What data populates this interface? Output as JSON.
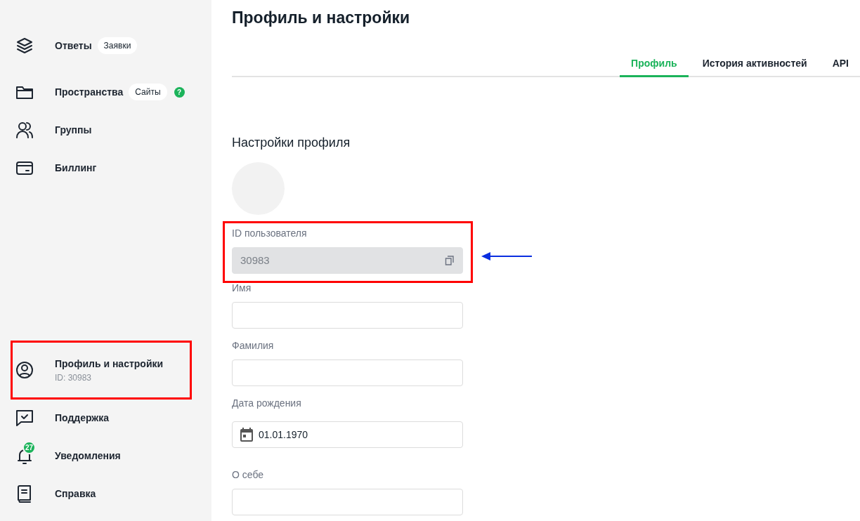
{
  "sidebar": {
    "top_items": [
      {
        "label": "Ответы",
        "tag": "Заявки"
      },
      {
        "label": "Пространства",
        "tag": "Сайты",
        "help": "?"
      },
      {
        "label": "Группы"
      },
      {
        "label": "Биллинг"
      }
    ],
    "bottom_items": [
      {
        "label": "Профиль и настройки",
        "sub": "ID: 30983",
        "annotated": true
      },
      {
        "label": "Поддержка",
        "annotated": false
      },
      {
        "label": "Уведомления",
        "count": "27",
        "annotated": false
      },
      {
        "label": "Справка",
        "annotated": false
      }
    ]
  },
  "page": {
    "title": "Профиль и настройки",
    "tabs": [
      {
        "label": "Профиль",
        "selected": true
      },
      {
        "label": "История активностей",
        "selected": false
      },
      {
        "label": "API",
        "selected": false
      }
    ],
    "section_title": "Настройки профиля",
    "fields": [
      {
        "kind": "readonly",
        "label": "ID пользователя",
        "value": "30983",
        "annotated": true
      },
      {
        "kind": "text",
        "label": "Имя",
        "annotated": false
      },
      {
        "kind": "text",
        "label": "Фамилия",
        "annotated": false
      },
      {
        "kind": "date",
        "label": "Дата рождения",
        "value": "01.01.1970",
        "annotated": false
      },
      {
        "kind": "text",
        "label": "О себе",
        "annotated": false
      }
    ]
  }
}
